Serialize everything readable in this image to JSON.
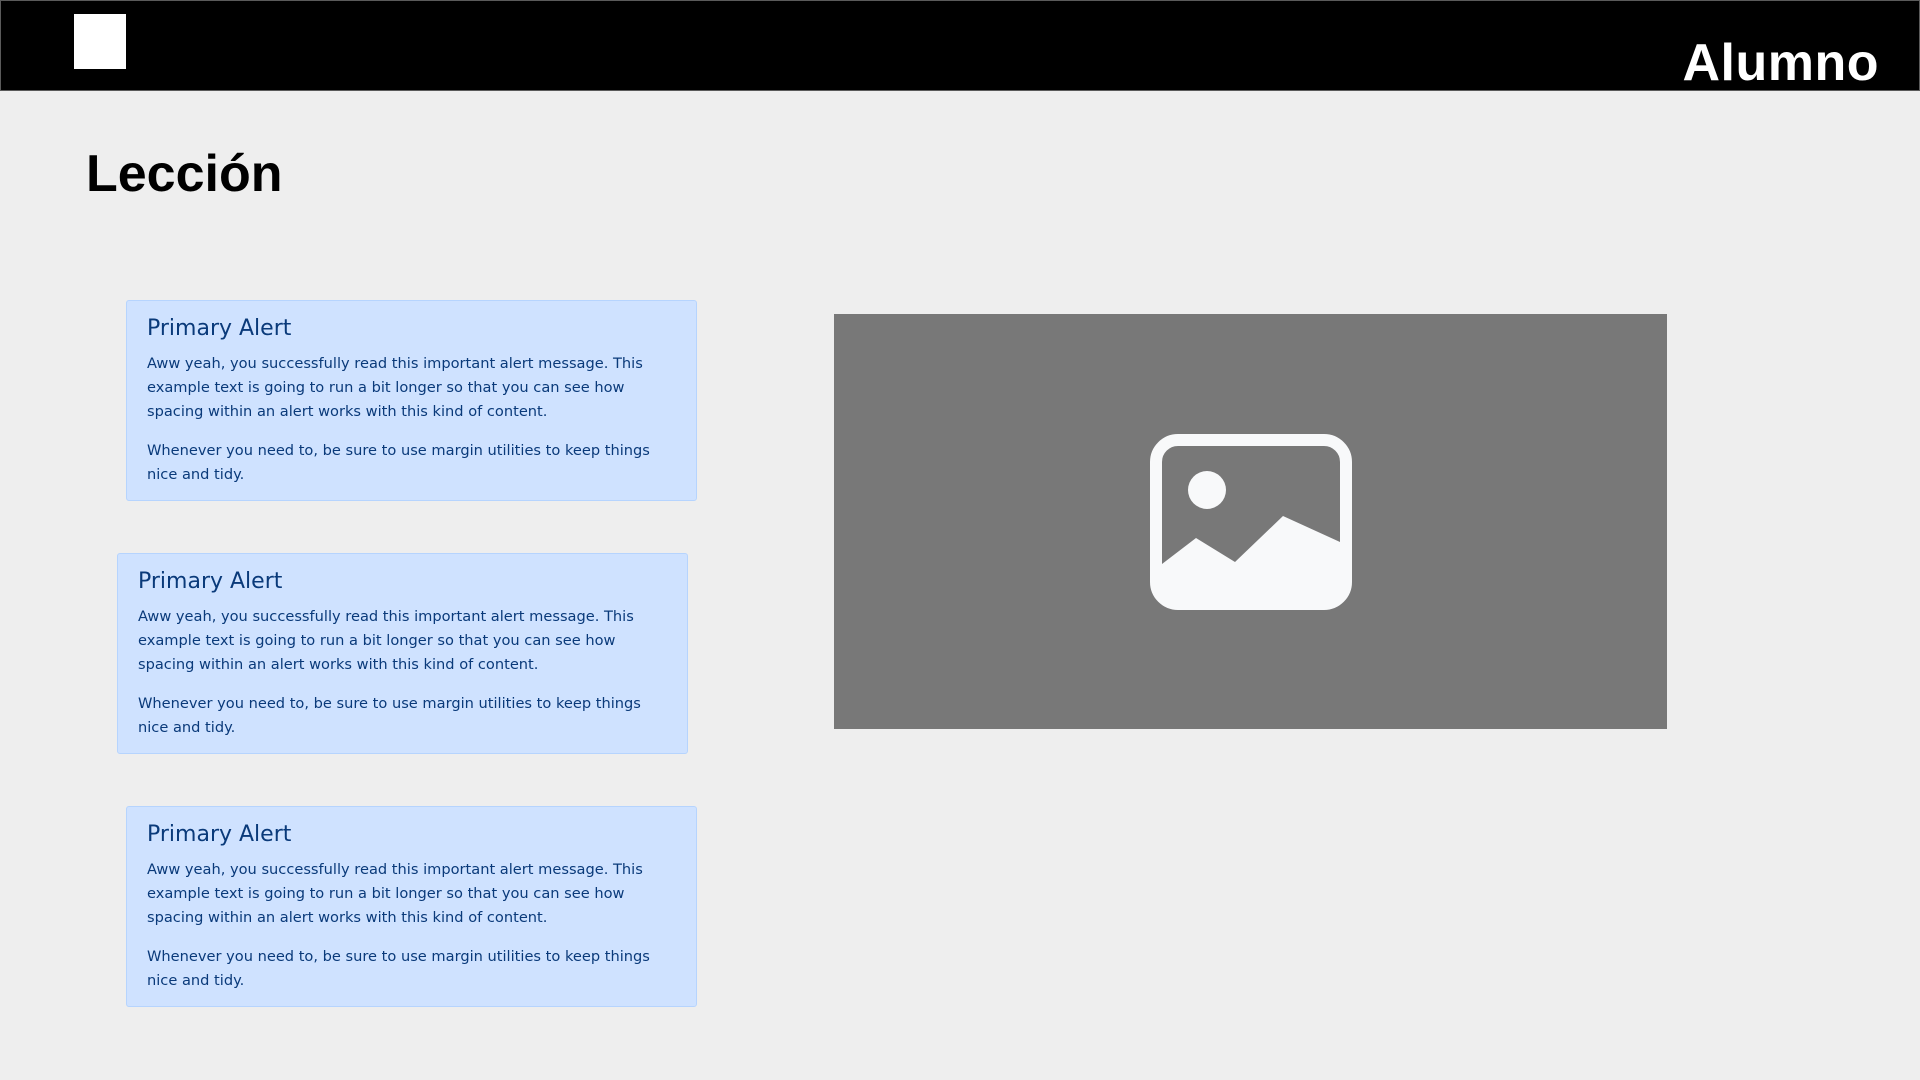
{
  "header": {
    "user_label": "Alumno"
  },
  "main": {
    "title": "Lección",
    "alerts": [
      {
        "heading": "Primary Alert",
        "text1": "Aww yeah, you successfully read this important alert message. This example text is going to run a bit longer so that you can see how spacing within an alert works with this kind of content.",
        "text2": "Whenever you need to, be sure to use margin utilities to keep things nice and tidy."
      },
      {
        "heading": "Primary Alert",
        "text1": "Aww yeah, you successfully read this important alert message. This example text is going to run a bit longer so that you can see how spacing within an alert works with this kind of content.",
        "text2": "Whenever you need to, be sure to use margin utilities to keep things nice and tidy."
      },
      {
        "heading": "Primary Alert",
        "text1": "Aww yeah, you successfully read this important alert message. This example text is going to run a bit longer so that you can see how spacing within an alert works with this kind of content.",
        "text2": "Whenever you need to, be sure to use margin utilities to keep things nice and tidy."
      }
    ],
    "media": {
      "icon": "image-placeholder-icon"
    }
  },
  "colors": {
    "header_bg": "#000000",
    "page_bg": "#eeeeee",
    "alert_bg": "#cfe2ff",
    "alert_border": "#b6d4fe",
    "alert_text": "#0a3a7a",
    "media_bg": "#787878",
    "icon_fill": "#f8f9fa"
  }
}
